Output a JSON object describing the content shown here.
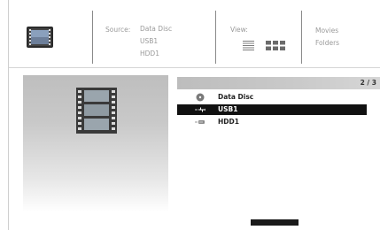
{
  "header": {
    "source_label": "Source:",
    "source_values": [
      "Data Disc",
      "USB1",
      "HDD1"
    ],
    "view_label": "View:",
    "filters": [
      "Movies",
      "Folders"
    ],
    "app_icon": "film-card-icon"
  },
  "list": {
    "page_indicator": "2 / 3",
    "items": [
      {
        "label": "Data Disc",
        "icon": "disc-icon",
        "selected": false
      },
      {
        "label": "USB1",
        "icon": "usb-icon",
        "selected": true
      },
      {
        "label": "HDD1",
        "icon": "hdd-icon",
        "selected": false
      }
    ]
  },
  "preview": {
    "icon": "film-strip-icon"
  },
  "colors": {
    "selection": "#111111",
    "panel": "#c4c4c4"
  }
}
